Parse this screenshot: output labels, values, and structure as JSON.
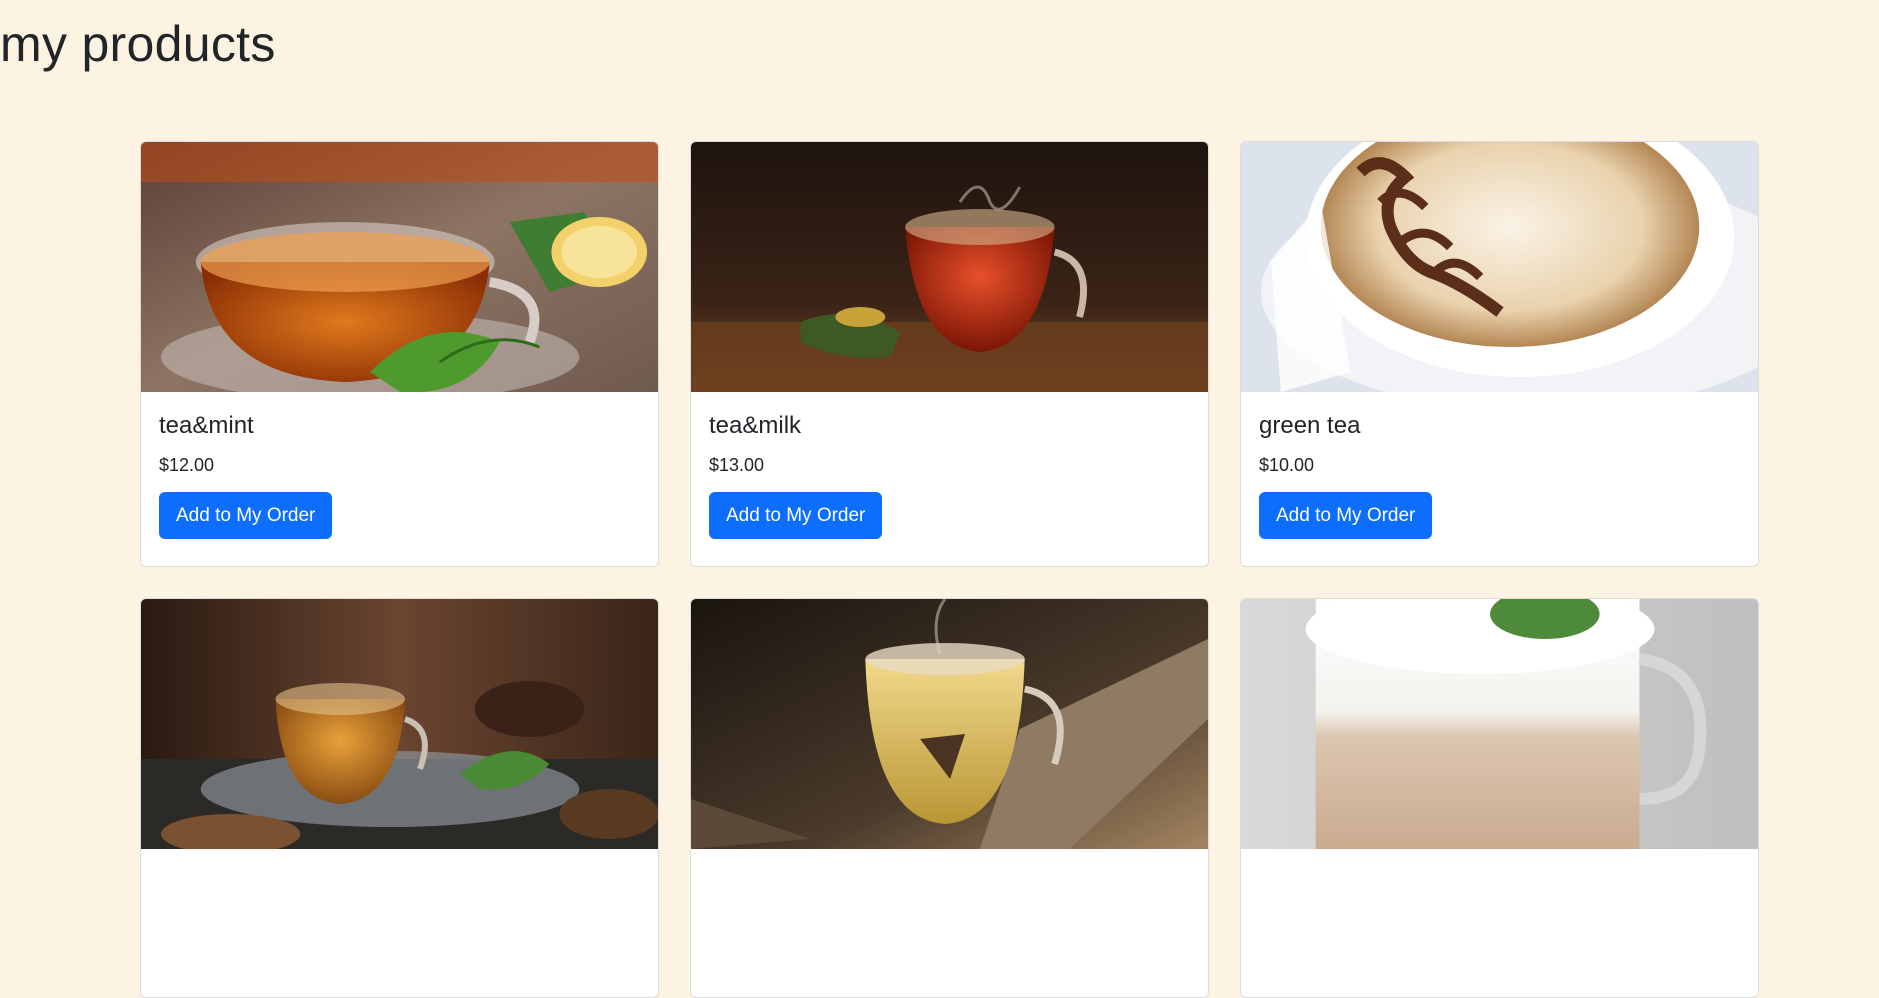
{
  "page": {
    "title": "my products"
  },
  "products": [
    {
      "name": "tea&mint",
      "price": "$12.00",
      "button_label": "Add to My Order"
    },
    {
      "name": "tea&milk",
      "price": "$13.00",
      "button_label": "Add to My Order"
    },
    {
      "name": "green tea",
      "price": "$10.00",
      "button_label": "Add to My Order"
    }
  ],
  "colors": {
    "page_background": "#fdf3e3",
    "button_primary": "#0d6efd"
  }
}
